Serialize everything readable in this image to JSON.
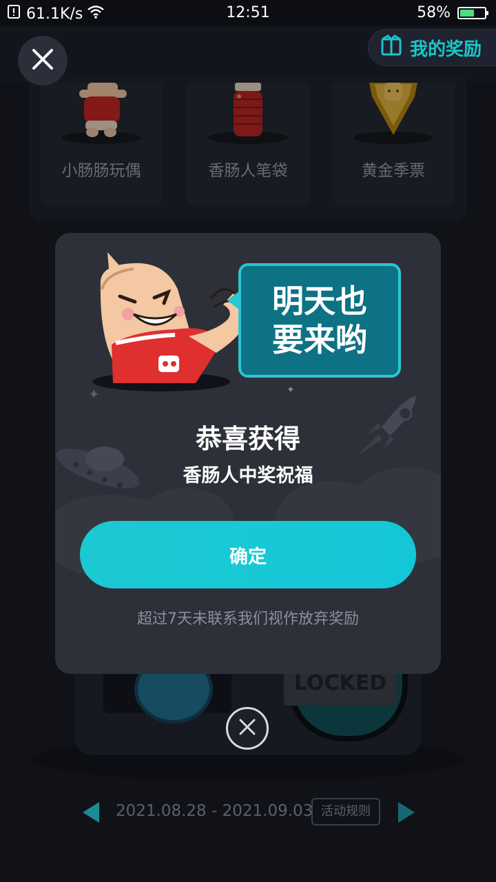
{
  "status_bar": {
    "network_speed": "61.1K/s",
    "time": "12:51",
    "battery": "58%",
    "battery_level": 0.58,
    "icons": [
      "notification-alert-icon",
      "wifi-icon",
      "battery-charging-icon"
    ]
  },
  "header": {
    "close_icon": "close-icon",
    "my_rewards_label": "我的奖励",
    "my_rewards_icon": "gift-box-icon"
  },
  "prizes": [
    {
      "name": "小肠肠玩偶"
    },
    {
      "name": "香肠人笔袋"
    },
    {
      "name": "黄金季票"
    }
  ],
  "background": {
    "locked_label": "LOCKED"
  },
  "dialog": {
    "speech_bubble": [
      "明天也",
      "要来哟"
    ],
    "title": "恭喜获得",
    "prize_text": "香肠人中奖祝福",
    "confirm_label": "确定",
    "note": "超过7天未联系我们视作放弃奖励",
    "close_icon": "close-circle-icon"
  },
  "footer": {
    "prev_icon": "arrow-left-icon",
    "date_range": "2021.08.28 - 2021.09.03",
    "rules_label": "活动规则",
    "next_icon": "arrow-right-icon"
  },
  "colors": {
    "accent": "#19c6c9",
    "background": "#16181f",
    "dialog": "#2d3039",
    "bubble": "#0e7285",
    "mascot_shirt": "#e02f2f"
  }
}
